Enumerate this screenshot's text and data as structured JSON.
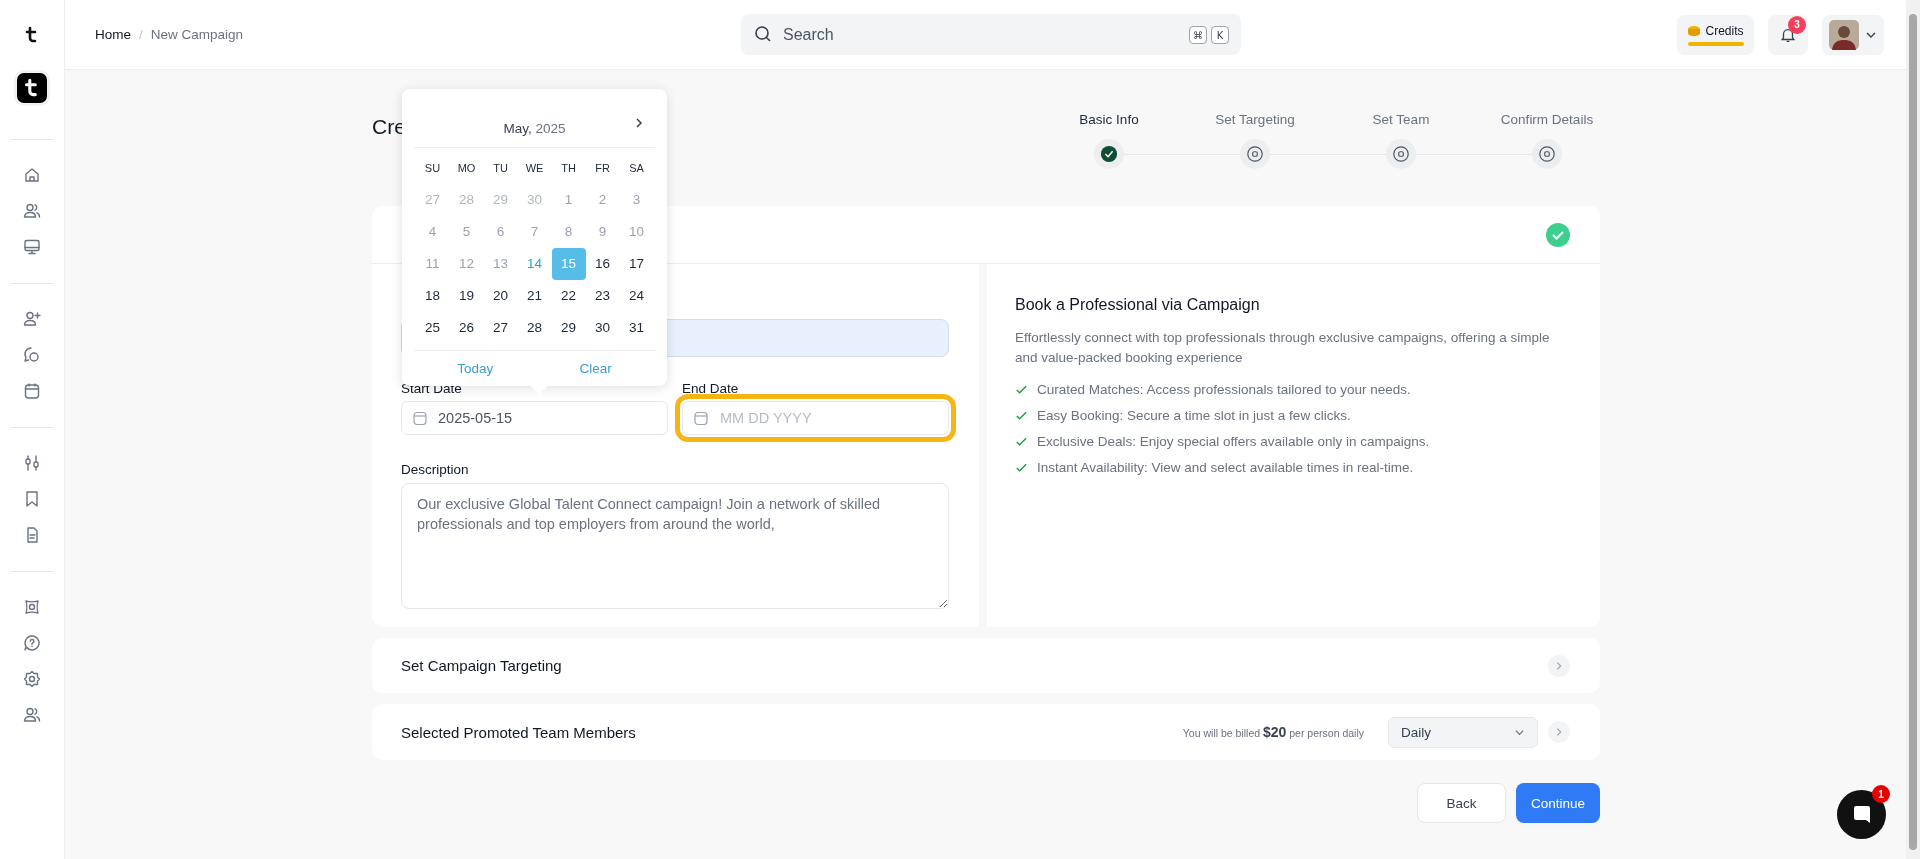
{
  "breadcrumb": [
    {
      "label": "Home",
      "selected": false
    },
    {
      "label": "New Campaign",
      "selected": true
    }
  ],
  "breadcrumb_separator": "/",
  "search": {
    "placeholder": "Search",
    "shortcut": [
      "⌘",
      "K"
    ]
  },
  "credits": {
    "label": "Credits"
  },
  "notifications": {
    "count": "3"
  },
  "page": {
    "title": "Cre"
  },
  "steps": [
    {
      "label": "Basic Info",
      "done": true
    },
    {
      "label": "Set Targeting",
      "done": false
    },
    {
      "label": "Set Team",
      "done": false
    },
    {
      "label": "Confirm Details",
      "done": false
    }
  ],
  "basic_card": {
    "complete": true,
    "start_date": {
      "label": "Start Date",
      "value": "2025-05-15"
    },
    "end_date": {
      "label": "End Date",
      "placeholder": "MM DD YYYY",
      "highlighted": true
    },
    "description": {
      "label": "Description",
      "value": "Our exclusive Global Talent Connect campaign! Join a network of skilled professionals and top employers from around the world,"
    }
  },
  "info": {
    "heading": "Book a Professional via Campaign",
    "intro": "Effortlessly connect with top professionals through exclusive campaigns, offering a simple and value-packed booking experience",
    "features": [
      "Curated Matches: Access professionals tailored to your needs.",
      "Easy Booking: Secure a time slot in just a few clicks.",
      "Exclusive Deals: Enjoy special offers available only in campaigns.",
      "Instant Availability: View and select available times in real-time."
    ]
  },
  "calendar": {
    "month": "May,",
    "year": "2025",
    "weekdays": [
      "SU",
      "MO",
      "TU",
      "WE",
      "TH",
      "FR",
      "SA"
    ],
    "days": [
      {
        "label": "27",
        "outside": true,
        "disabled": true,
        "today": false,
        "selected": false
      },
      {
        "label": "28",
        "outside": true,
        "disabled": true,
        "today": false,
        "selected": false
      },
      {
        "label": "29",
        "outside": true,
        "disabled": true,
        "today": false,
        "selected": false
      },
      {
        "label": "30",
        "outside": true,
        "disabled": true,
        "today": false,
        "selected": false
      },
      {
        "label": "1",
        "outside": false,
        "disabled": true,
        "today": false,
        "selected": false
      },
      {
        "label": "2",
        "outside": false,
        "disabled": true,
        "today": false,
        "selected": false
      },
      {
        "label": "3",
        "outside": false,
        "disabled": true,
        "today": false,
        "selected": false
      },
      {
        "label": "4",
        "outside": false,
        "disabled": true,
        "today": false,
        "selected": false
      },
      {
        "label": "5",
        "outside": false,
        "disabled": true,
        "today": false,
        "selected": false
      },
      {
        "label": "6",
        "outside": false,
        "disabled": true,
        "today": false,
        "selected": false
      },
      {
        "label": "7",
        "outside": false,
        "disabled": true,
        "today": false,
        "selected": false
      },
      {
        "label": "8",
        "outside": false,
        "disabled": true,
        "today": false,
        "selected": false
      },
      {
        "label": "9",
        "outside": false,
        "disabled": true,
        "today": false,
        "selected": false
      },
      {
        "label": "10",
        "outside": false,
        "disabled": true,
        "today": false,
        "selected": false
      },
      {
        "label": "11",
        "outside": false,
        "disabled": true,
        "today": false,
        "selected": false
      },
      {
        "label": "12",
        "outside": false,
        "disabled": true,
        "today": false,
        "selected": false
      },
      {
        "label": "13",
        "outside": false,
        "disabled": true,
        "today": false,
        "selected": false
      },
      {
        "label": "14",
        "outside": false,
        "disabled": false,
        "today": true,
        "selected": false
      },
      {
        "label": "15",
        "outside": false,
        "disabled": false,
        "today": false,
        "selected": true
      },
      {
        "label": "16",
        "outside": false,
        "disabled": false,
        "today": false,
        "selected": false
      },
      {
        "label": "17",
        "outside": false,
        "disabled": false,
        "today": false,
        "selected": false
      },
      {
        "label": "18",
        "outside": false,
        "disabled": false,
        "today": false,
        "selected": false
      },
      {
        "label": "19",
        "outside": false,
        "disabled": false,
        "today": false,
        "selected": false
      },
      {
        "label": "20",
        "outside": false,
        "disabled": false,
        "today": false,
        "selected": false
      },
      {
        "label": "21",
        "outside": false,
        "disabled": false,
        "today": false,
        "selected": false
      },
      {
        "label": "22",
        "outside": false,
        "disabled": false,
        "today": false,
        "selected": false
      },
      {
        "label": "23",
        "outside": false,
        "disabled": false,
        "today": false,
        "selected": false
      },
      {
        "label": "24",
        "outside": false,
        "disabled": false,
        "today": false,
        "selected": false
      },
      {
        "label": "25",
        "outside": false,
        "disabled": false,
        "today": false,
        "selected": false
      },
      {
        "label": "26",
        "outside": false,
        "disabled": false,
        "today": false,
        "selected": false
      },
      {
        "label": "27",
        "outside": false,
        "disabled": false,
        "today": false,
        "selected": false
      },
      {
        "label": "28",
        "outside": false,
        "disabled": false,
        "today": false,
        "selected": false
      },
      {
        "label": "29",
        "outside": false,
        "disabled": false,
        "today": false,
        "selected": false
      },
      {
        "label": "30",
        "outside": false,
        "disabled": false,
        "today": false,
        "selected": false
      },
      {
        "label": "31",
        "outside": false,
        "disabled": false,
        "today": false,
        "selected": false
      }
    ],
    "actions": [
      "Today",
      "Clear"
    ]
  },
  "sections": [
    {
      "title": "Set Campaign Targeting"
    },
    {
      "title": "Selected Promoted Team Members",
      "billing": "You will be billed **$20** per person daily",
      "select": "Daily"
    }
  ],
  "buttons": [
    {
      "label": "Back",
      "kind": "secondary"
    },
    {
      "label": "Continue",
      "kind": "primary"
    }
  ],
  "chat": {
    "badge": "1"
  }
}
